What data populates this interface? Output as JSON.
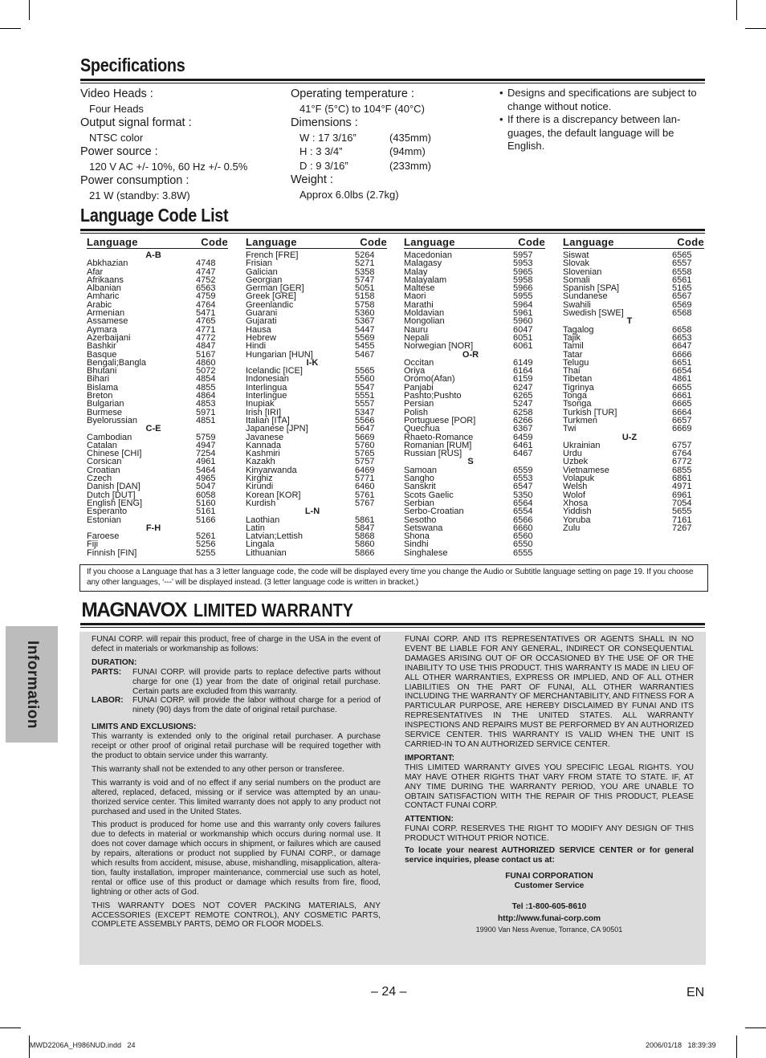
{
  "specifications": {
    "title": "Specifications",
    "left": [
      {
        "label": "Video Heads :",
        "value": "Four Heads"
      },
      {
        "label": "Output signal format :",
        "value": "NTSC color"
      },
      {
        "label": "Power source :",
        "value": "120 V AC +/- 10%, 60 Hz +/- 0.5%"
      },
      {
        "label": "Power consumption :",
        "value": "21 W (standby: 3.8W)"
      }
    ],
    "operating_temperature": {
      "label": "Operating temperature :",
      "value": "41°F (5°C) to 104°F (40°C)"
    },
    "dimensions": {
      "label": "Dimensions :",
      "rows": [
        {
          "dim": "W : 17 3/16”",
          "metric": "(435mm)"
        },
        {
          "dim": "H  : 3 3/4”",
          "metric": "(94mm)"
        },
        {
          "dim": "D  : 9 3/16”",
          "metric": "(233mm)"
        }
      ]
    },
    "weight": {
      "label": "Weight :",
      "value": "Approx  6.0lbs (2.7kg)"
    },
    "notes": [
      "Designs and specifications are subject to change without notice.",
      "If there is a discrepancy between lan-guages, the default language will be English."
    ]
  },
  "language_code_list": {
    "title": "Language Code List",
    "header": {
      "language": "Language",
      "code": "Code"
    },
    "columns": [
      [
        {
          "group": "A-B"
        },
        {
          "name": "Abkhazian",
          "code": "4748"
        },
        {
          "name": "Afar",
          "code": "4747"
        },
        {
          "name": "Afrikaans",
          "code": "4752"
        },
        {
          "name": "Albanian",
          "code": "6563"
        },
        {
          "name": "Amharic",
          "code": "4759"
        },
        {
          "name": "Arabic",
          "code": "4764"
        },
        {
          "name": "Armenian",
          "code": "5471"
        },
        {
          "name": "Assamese",
          "code": "4765"
        },
        {
          "name": "Aymara",
          "code": "4771"
        },
        {
          "name": "Azerbaijani",
          "code": "4772"
        },
        {
          "name": "Bashkir",
          "code": "4847"
        },
        {
          "name": "Basque",
          "code": "5167"
        },
        {
          "name": "Bengali;Bangla",
          "code": "4860"
        },
        {
          "name": "Bhutani",
          "code": "5072"
        },
        {
          "name": "Bihari",
          "code": "4854"
        },
        {
          "name": "Bislama",
          "code": "4855"
        },
        {
          "name": "Breton",
          "code": "4864"
        },
        {
          "name": "Bulgarian",
          "code": "4853"
        },
        {
          "name": "Burmese",
          "code": "5971"
        },
        {
          "name": "Byelorussian",
          "code": "4851"
        },
        {
          "group": "C-E"
        },
        {
          "name": "Cambodian",
          "code": "5759"
        },
        {
          "name": "Catalan",
          "code": "4947"
        },
        {
          "name": "Chinese [CHI]",
          "code": "7254"
        },
        {
          "name": "Corsican",
          "code": "4961"
        },
        {
          "name": "Croatian",
          "code": "5464"
        },
        {
          "name": "Czech",
          "code": "4965"
        },
        {
          "name": "Danish [DAN]",
          "code": "5047"
        },
        {
          "name": "Dutch [DUT]",
          "code": "6058"
        },
        {
          "name": "English [ENG]",
          "code": "5160"
        },
        {
          "name": "Esperanto",
          "code": "5161"
        },
        {
          "name": "Estonian",
          "code": "5166"
        },
        {
          "group": "F-H"
        },
        {
          "name": "Faroese",
          "code": "5261"
        },
        {
          "name": "Fiji",
          "code": "5256"
        },
        {
          "name": "Finnish [FIN]",
          "code": "5255"
        }
      ],
      [
        {
          "name": "French [FRE]",
          "code": "5264"
        },
        {
          "name": "Frisian",
          "code": "5271"
        },
        {
          "name": "Galician",
          "code": "5358"
        },
        {
          "name": "Georgian",
          "code": "5747"
        },
        {
          "name": "German [GER]",
          "code": "5051"
        },
        {
          "name": "Greek [GRE]",
          "code": "5158"
        },
        {
          "name": "Greenlandic",
          "code": "5758"
        },
        {
          "name": "Guarani",
          "code": "5360"
        },
        {
          "name": "Gujarati",
          "code": "5367"
        },
        {
          "name": "Hausa",
          "code": "5447"
        },
        {
          "name": "Hebrew",
          "code": "5569"
        },
        {
          "name": "Hindi",
          "code": "5455"
        },
        {
          "name": "Hungarian [HUN]",
          "code": "5467"
        },
        {
          "group": "I-K"
        },
        {
          "name": "Icelandic [ICE]",
          "code": "5565"
        },
        {
          "name": "Indonesian",
          "code": "5560"
        },
        {
          "name": "Interlingua",
          "code": "5547"
        },
        {
          "name": "Interlingue",
          "code": "5551"
        },
        {
          "name": "Inupiak",
          "code": "5557"
        },
        {
          "name": "Irish [IRI]",
          "code": "5347"
        },
        {
          "name": "Italian [ITA]",
          "code": "5566"
        },
        {
          "name": "Japanese [JPN]",
          "code": "5647"
        },
        {
          "name": "Javanese",
          "code": "5669"
        },
        {
          "name": "Kannada",
          "code": "5760"
        },
        {
          "name": "Kashmiri",
          "code": "5765"
        },
        {
          "name": "Kazakh",
          "code": "5757"
        },
        {
          "name": "Kinyarwanda",
          "code": "6469"
        },
        {
          "name": "Kirghiz",
          "code": "5771"
        },
        {
          "name": "Kirundi",
          "code": "6460"
        },
        {
          "name": "Korean [KOR]",
          "code": "5761"
        },
        {
          "name": "Kurdish",
          "code": "5767"
        },
        {
          "group": "L-N"
        },
        {
          "name": "Laothian",
          "code": "5861"
        },
        {
          "name": "Latin",
          "code": "5847"
        },
        {
          "name": "Latvian;Lettish",
          "code": "5868"
        },
        {
          "name": "Lingala",
          "code": "5860"
        },
        {
          "name": "Lithuanian",
          "code": "5866"
        }
      ],
      [
        {
          "name": "Macedonian",
          "code": "5957"
        },
        {
          "name": "Malagasy",
          "code": "5953"
        },
        {
          "name": "Malay",
          "code": "5965"
        },
        {
          "name": "Malayalam",
          "code": "5958"
        },
        {
          "name": "Maltese",
          "code": "5966"
        },
        {
          "name": "Maori",
          "code": "5955"
        },
        {
          "name": "Marathi",
          "code": "5964"
        },
        {
          "name": "Moldavian",
          "code": "5961"
        },
        {
          "name": "Mongolian",
          "code": "5960"
        },
        {
          "name": "Nauru",
          "code": "6047"
        },
        {
          "name": "Nepali",
          "code": "6051"
        },
        {
          "name": "Norwegian [NOR]",
          "code": "6061"
        },
        {
          "group": "O-R"
        },
        {
          "name": "Occitan",
          "code": "6149"
        },
        {
          "name": "Oriya",
          "code": "6164"
        },
        {
          "name": "Oromo(Afan)",
          "code": "6159"
        },
        {
          "name": "Panjabi",
          "code": "6247"
        },
        {
          "name": "Pashto;Pushto",
          "code": "6265"
        },
        {
          "name": "Persian",
          "code": "5247"
        },
        {
          "name": "Polish",
          "code": "6258"
        },
        {
          "name": "Portuguese [POR]",
          "code": "6266"
        },
        {
          "name": "Quechua",
          "code": "6367"
        },
        {
          "name": "Rhaeto-Romance",
          "code": "6459"
        },
        {
          "name": "Romanian [RUM]",
          "code": "6461"
        },
        {
          "name": "Russian [RUS]",
          "code": "6467"
        },
        {
          "group": "S"
        },
        {
          "name": "Samoan",
          "code": "6559"
        },
        {
          "name": "Sangho",
          "code": "6553"
        },
        {
          "name": "Sanskrit",
          "code": "6547"
        },
        {
          "name": "Scots Gaelic",
          "code": "5350"
        },
        {
          "name": "Serbian",
          "code": "6564"
        },
        {
          "name": "Serbo-Croatian",
          "code": "6554"
        },
        {
          "name": "Sesotho",
          "code": "6566"
        },
        {
          "name": "Setswana",
          "code": "6660"
        },
        {
          "name": "Shona",
          "code": "6560"
        },
        {
          "name": "Sindhi",
          "code": "6550"
        },
        {
          "name": "Singhalese",
          "code": "6555"
        }
      ],
      [
        {
          "name": "Siswat",
          "code": "6565"
        },
        {
          "name": "Slovak",
          "code": "6557"
        },
        {
          "name": "Slovenian",
          "code": "6558"
        },
        {
          "name": "Somali",
          "code": "6561"
        },
        {
          "name": "Spanish [SPA]",
          "code": "5165"
        },
        {
          "name": "Sundanese",
          "code": "6567"
        },
        {
          "name": "Swahili",
          "code": "6569"
        },
        {
          "name": "Swedish [SWE]",
          "code": "6568"
        },
        {
          "group": "T"
        },
        {
          "name": "Tagalog",
          "code": "6658"
        },
        {
          "name": "Tajik",
          "code": "6653"
        },
        {
          "name": "Tamil",
          "code": "6647"
        },
        {
          "name": "Tatar",
          "code": "6666"
        },
        {
          "name": "Telugu",
          "code": "6651"
        },
        {
          "name": "Thai",
          "code": "6654"
        },
        {
          "name": "Tibetan",
          "code": "4861"
        },
        {
          "name": "Tigrinya",
          "code": "6655"
        },
        {
          "name": "Tonga",
          "code": "6661"
        },
        {
          "name": "Tsonga",
          "code": "6665"
        },
        {
          "name": "Turkish [TUR]",
          "code": "6664"
        },
        {
          "name": "Turkmen",
          "code": "6657"
        },
        {
          "name": "Twi",
          "code": "6669"
        },
        {
          "group": "U-Z"
        },
        {
          "name": "Ukrainian",
          "code": "6757"
        },
        {
          "name": "Urdu",
          "code": "6764"
        },
        {
          "name": "Uzbek",
          "code": "6772"
        },
        {
          "name": "Vietnamese",
          "code": "6855"
        },
        {
          "name": "Volapuk",
          "code": "6861"
        },
        {
          "name": "Welsh",
          "code": "4971"
        },
        {
          "name": "Wolof",
          "code": "6961"
        },
        {
          "name": "Xhosa",
          "code": "7054"
        },
        {
          "name": "Yiddish",
          "code": "5655"
        },
        {
          "name": "Yoruba",
          "code": "7161"
        },
        {
          "name": "Zulu",
          "code": "7267"
        }
      ]
    ],
    "note": "If you choose a Language that has a 3 letter language code, the code will be displayed every time you change the Audio or Subtitle language setting on page 19. If you choose any other languages, ‘---’ will be displayed instead. (3 letter language code is written in bracket.)"
  },
  "warranty": {
    "brand": "MAGNAVOX",
    "title": "LIMITED WARRANTY",
    "left": {
      "intro": "FUNAI CORP. will repair this product, free of charge in the USA in the event of defect in materials or workmanship as follows:",
      "duration_heading": "DURATION:",
      "parts_label": "PARTS:",
      "parts_text": "FUNAI CORP. will provide parts to replace defective parts without charge for one (1) year from the date of original retail purchase. Certain parts are excluded from this warranty.",
      "labor_label": "LABOR:",
      "labor_text": "FUNAI CORP. will provide the labor without charge for a period of ninety (90) days from the date of original retail purchase.",
      "limits_heading": "LIMITS AND EXCLUSIONS:",
      "paragraphs": [
        "This warranty is extended only to the original retail purchaser. A purchase receipt or other proof of original retail purchase will be required together with the product to obtain service under this warranty.",
        "This warranty shall not be extended to any other person or transferee.",
        "This warranty is void and of no effect if any serial numbers on the product are altered, replaced, defaced, missing or if service was attempted by an unau-thorized service center. This limited warranty does not apply to any product not purchased and used in the United States.",
        "This product is produced for home use and this warranty only covers failures due to defects in material or workmanship which occurs during normal use. It does not cover damage which occurs in shipment, or failures which are caused by repairs, alterations or product not supplied by FUNAI CORP., or damage which results from accident, misuse, abuse, mishandling, misapplication, altera-tion, faulty installation, improper maintenance, commercial use such as hotel, rental or office use of this product or damage which results from fire, flood, lightning or other acts of God.",
        "THIS WARRANTY DOES NOT COVER PACKING MATERIALS, ANY ACCESSORIES (EXCEPT REMOTE CONTROL), ANY COSMETIC PARTS, COMPLETE ASSEMBLY PARTS, DEMO OR FLOOR MODELS."
      ]
    },
    "right": {
      "disclaimer": "FUNAI CORP. AND ITS REPRESENTATIVES OR AGENTS SHALL IN NO EVENT BE LIABLE FOR ANY GENERAL, INDIRECT OR CONSEQUENTIAL DAMAGES ARISING OUT OF OR OCCASIONED BY THE USE OF OR THE INABILITY TO USE THIS PRODUCT. THIS WARRANTY IS MADE IN LIEU OF ALL OTHER WARRANTIES, EXPRESS OR IMPLIED, AND OF ALL OTHER LIABILITIES ON THE PART OF FUNAI, ALL OTHER WARRANTIES INCLUDING THE WARRANTY OF MERCHANTABILITY, AND FITNESS FOR A PARTICULAR PURPOSE, ARE HEREBY DISCLAIMED BY FUNAI AND ITS REPRESENTATIVES IN THE UNITED STATES. ALL WARRANTY INSPECTIONS AND REPAIRS MUST BE PERFORMED BY AN AUTHORIZED SERVICE CENTER. THIS WARRANTY IS VALID WHEN THE UNIT IS CARRIED-IN TO AN AUTHORIZED SERVICE CENTER.",
      "important_heading": "IMPORTANT:",
      "important_text": "THIS LIMITED WARRANTY GIVES YOU SPECIFIC LEGAL RIGHTS. YOU MAY HAVE OTHER RIGHTS THAT VARY FROM STATE TO STATE. IF, AT ANY TIME DURING THE WARRANTY PERIOD, YOU ARE UNABLE TO OBTAIN SATISFACTION WITH THE REPAIR OF THIS PRODUCT, PLEASE CONTACT FUNAI CORP.",
      "attention_heading": "ATTENTION:",
      "attention_text": "FUNAI CORP. RESERVES THE RIGHT TO MODIFY ANY DESIGN OF THIS PRODUCT WITHOUT PRIOR NOTICE.",
      "locate_text": "To locate your nearest AUTHORIZED SERVICE CENTER or for general service inquiries, please contact us at:",
      "company": "FUNAI CORPORATION",
      "department": "Customer Service",
      "tel": "Tel :1-800-605-8610",
      "url": "http://www.funai-corp.com",
      "address": "19900 Van Ness Avenue, Torrance, CA 90501"
    }
  },
  "side_tab": "Information",
  "footer": {
    "page_number": "– 24 –",
    "language": "EN",
    "slug_file": "MWD2206A_H986NUD.indd   24",
    "slug_date": "2006/01/18   18:39:39"
  }
}
